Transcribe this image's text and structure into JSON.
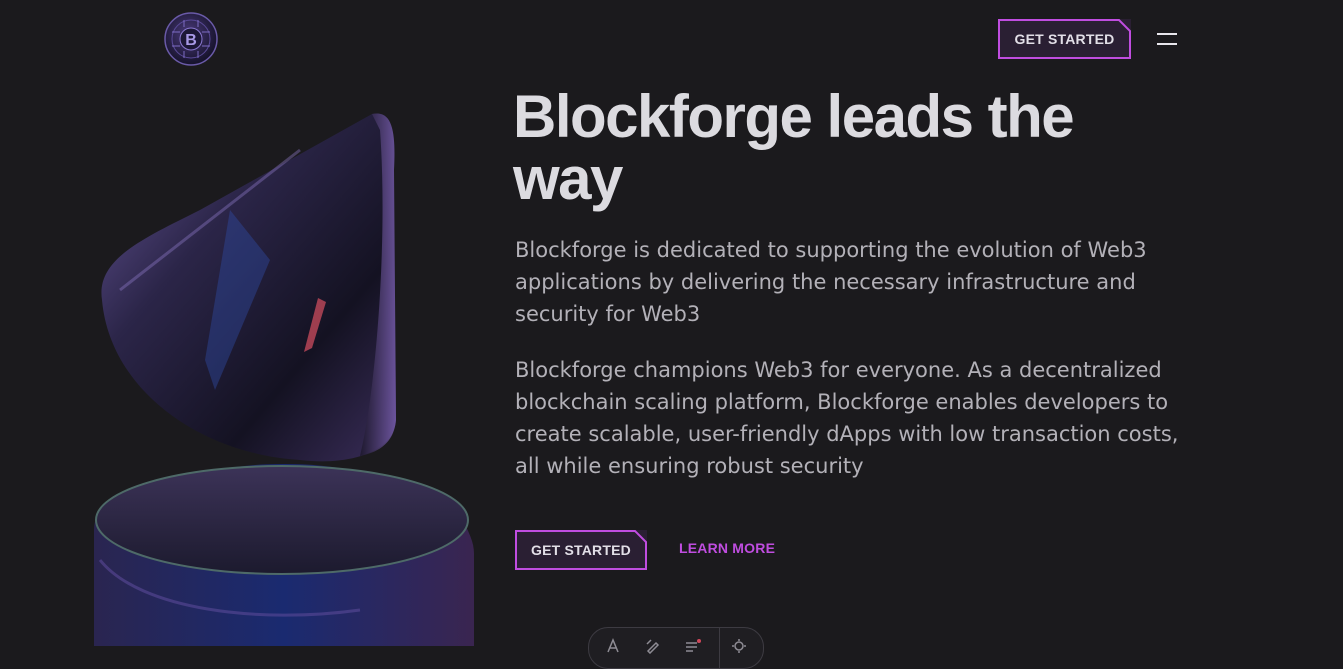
{
  "brand": {
    "logo_icon": "bitcoin-circuit-logo",
    "logo_letter": "B"
  },
  "nav": {
    "cta_label": "GET STARTED",
    "menu_icon": "hamburger-menu-icon"
  },
  "hero": {
    "title": "Blockforge leads the way",
    "paragraph1": "Blockforge is dedicated to supporting the evolution of Web3 applications by delivering the necessary infrastructure and security for Web3",
    "paragraph2": "Blockforge champions Web3 for everyone. As a decentralized blockchain scaling platform, Blockforge enables developers to create scalable, user-friendly dApps with low transaction costs, all while ensuring robust security",
    "primary_cta": "GET STARTED",
    "secondary_cta": "LEARN MORE"
  },
  "toolbar": {
    "icons": [
      "text-icon",
      "pen-icon",
      "list-icon",
      "settings-icon"
    ]
  },
  "colors": {
    "background": "#1b1a1d",
    "accent": "#c04de0",
    "button_fill": "#2a1f33",
    "heading": "#dcdbe0",
    "body_text": "#b3b1b8"
  }
}
